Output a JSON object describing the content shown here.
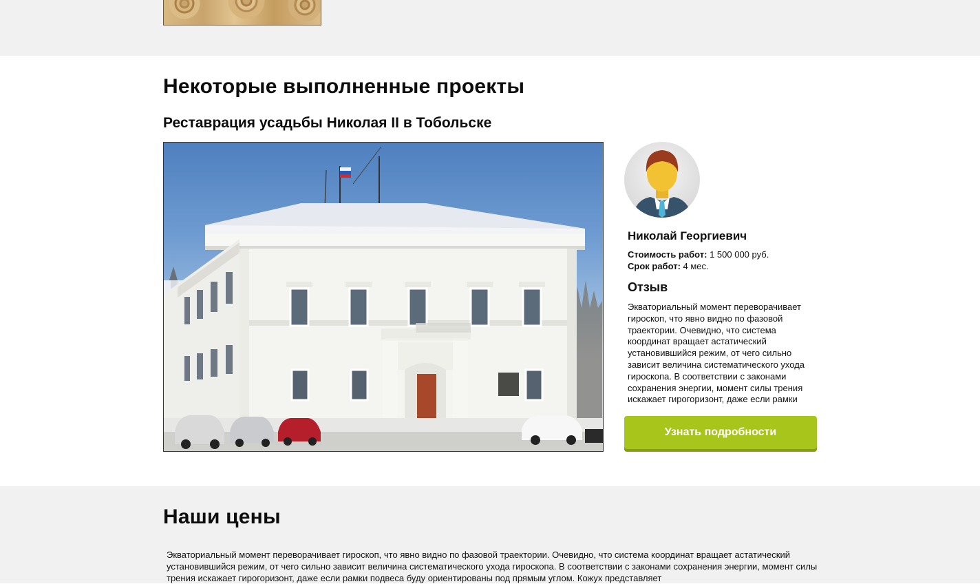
{
  "projects_section": {
    "heading": "Некоторые выполненные проекты",
    "project_title": "Реставрация усадьбы Николая II  в Тобольске",
    "client_name": "Николай Георгиевич",
    "cost_label": "Стоимость работ:",
    "cost_value": "1 500 000 руб.",
    "duration_label": "Срок работ:",
    "duration_value": "4 мес.",
    "review_title": "Отзыв",
    "review_text": "Экваториальный момент переворачивает гироскоп, что явно видно по фазовой траектории. Очевидно, что система координат вращает астатический установившийся режим, от чего сильно зависит величина систематического ухода гироскопа. В соответствии с законами сохранения энергии, момент силы трения искажает гирогоризонт, даже если рамки подвеса буду ориентированы под прямым углом.",
    "cta_label": "Узнать подробности"
  },
  "prices_section": {
    "heading": "Наши цены",
    "text": "Экваториальный момент переворачивает гироскоп, что явно видно по фазовой траектории. Очевидно, что система координат вращает астатический установившийся режим, от чего сильно зависит величина систематического ухода гироскопа. В соответствии с законами сохранения энергии, момент силы трения искажает гирогоризонт, даже если рамки подвеса буду ориентированы под прямым углом. Кожух представляет"
  },
  "colors": {
    "accent_button": "#a7c51a",
    "band_gray": "#f1f1f1"
  },
  "icons": {
    "avatar": "person-avatar-icon",
    "flag": "russian-flag-icon"
  }
}
